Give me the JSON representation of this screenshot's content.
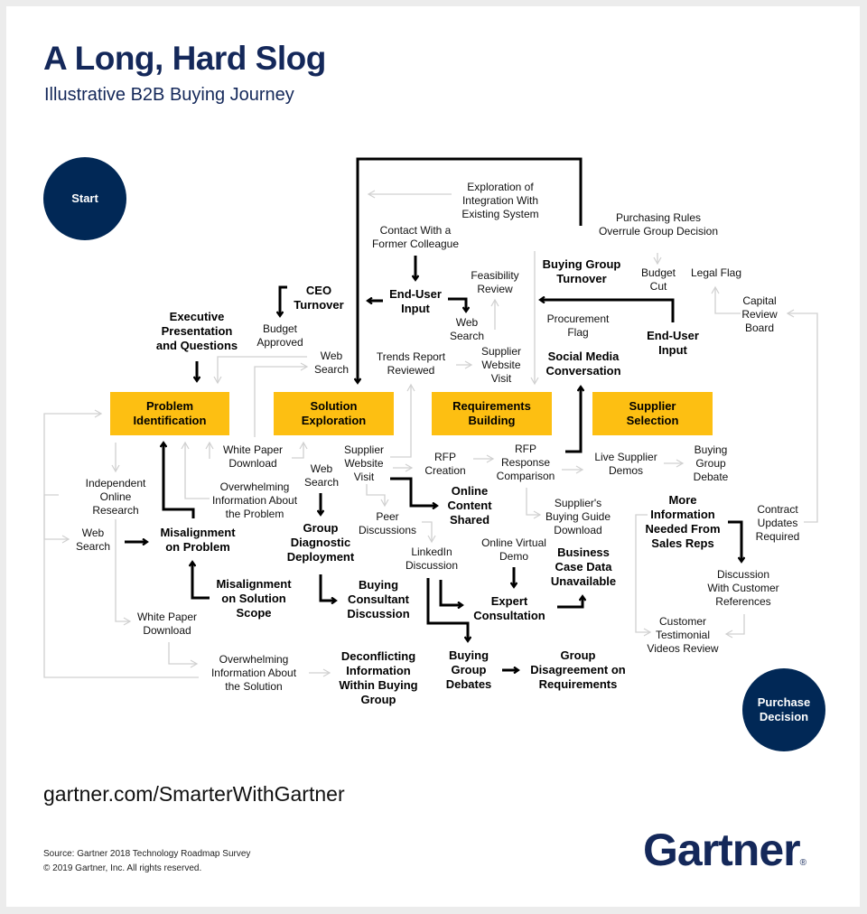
{
  "header": {
    "title": "A Long, Hard Slog",
    "subtitle": "Illustrative B2B Buying Journey"
  },
  "endpoints": {
    "start": "Start",
    "end": "Purchase\nDecision"
  },
  "stages": [
    {
      "id": "problem",
      "label": "Problem\nIdentification"
    },
    {
      "id": "solution",
      "label": "Solution\nExploration"
    },
    {
      "id": "requirements",
      "label": "Requirements\nBuilding"
    },
    {
      "id": "supplier",
      "label": "Supplier\nSelection"
    }
  ],
  "activities": [
    {
      "id": "exploration-integration",
      "label": "Exploration of\nIntegration With\nExisting System",
      "bold": false
    },
    {
      "id": "contact-colleague",
      "label": "Contact With a\nFormer Colleague",
      "bold": false
    },
    {
      "id": "purchasing-rules",
      "label": "Purchasing Rules\nOverrule Group Decision",
      "bold": false
    },
    {
      "id": "buying-group-turnover",
      "label": "Buying Group\nTurnover",
      "bold": true
    },
    {
      "id": "budget-cut",
      "label": "Budget\nCut",
      "bold": false
    },
    {
      "id": "legal-flag",
      "label": "Legal Flag",
      "bold": false
    },
    {
      "id": "ceo-turnover",
      "label": "CEO\nTurnover",
      "bold": true
    },
    {
      "id": "end-user-input-1",
      "label": "End-User\nInput",
      "bold": true
    },
    {
      "id": "feasibility-review",
      "label": "Feasibility\nReview",
      "bold": false
    },
    {
      "id": "capital-review-board",
      "label": "Capital\nReview\nBoard",
      "bold": false
    },
    {
      "id": "executive-presentation",
      "label": "Executive\nPresentation\nand Questions",
      "bold": true
    },
    {
      "id": "budget-approved",
      "label": "Budget\nApproved",
      "bold": false
    },
    {
      "id": "web-search-1",
      "label": "Web\nSearch",
      "bold": false
    },
    {
      "id": "procurement-flag",
      "label": "Procurement\nFlag",
      "bold": false
    },
    {
      "id": "end-user-input-2",
      "label": "End-User\nInput",
      "bold": true
    },
    {
      "id": "web-search-2",
      "label": "Web\nSearch",
      "bold": false
    },
    {
      "id": "trends-report",
      "label": "Trends Report\nReviewed",
      "bold": false
    },
    {
      "id": "supplier-website-1",
      "label": "Supplier\nWebsite\nVisit",
      "bold": false
    },
    {
      "id": "social-media",
      "label": "Social Media\nConversation",
      "bold": true
    },
    {
      "id": "white-paper-1",
      "label": "White Paper\nDownload",
      "bold": false
    },
    {
      "id": "supplier-website-2",
      "label": "Supplier\nWebsite\nVisit",
      "bold": false
    },
    {
      "id": "rfp-creation",
      "label": "RFP\nCreation",
      "bold": false
    },
    {
      "id": "rfp-response",
      "label": "RFP\nResponse\nComparison",
      "bold": false
    },
    {
      "id": "live-demos",
      "label": "Live Supplier\nDemos",
      "bold": false
    },
    {
      "id": "buying-group-debate",
      "label": "Buying\nGroup\nDebate",
      "bold": false
    },
    {
      "id": "independent-research",
      "label": "Independent\nOnline\nResearch",
      "bold": false
    },
    {
      "id": "overwhelming-problem",
      "label": "Overwhelming\nInformation About\nthe Problem",
      "bold": false
    },
    {
      "id": "web-search-3",
      "label": "Web\nSearch",
      "bold": false
    },
    {
      "id": "online-content",
      "label": "Online\nContent\nShared",
      "bold": true
    },
    {
      "id": "suppliers-guide",
      "label": "Supplier's\nBuying Guide\nDownload",
      "bold": false
    },
    {
      "id": "more-information",
      "label": "More\nInformation\nNeeded From\nSales Reps",
      "bold": true
    },
    {
      "id": "contract-updates",
      "label": "Contract\nUpdates\nRequired",
      "bold": false
    },
    {
      "id": "web-search-4",
      "label": "Web\nSearch",
      "bold": false
    },
    {
      "id": "misalignment-problem",
      "label": "Misalignment\non Problem",
      "bold": true
    },
    {
      "id": "group-diagnostic",
      "label": "Group\nDiagnostic\nDeployment",
      "bold": true
    },
    {
      "id": "peer-discussions",
      "label": "Peer\nDiscussions",
      "bold": false
    },
    {
      "id": "linkedin",
      "label": "LinkedIn\nDiscussion",
      "bold": false
    },
    {
      "id": "online-virtual-demo",
      "label": "Online Virtual\nDemo",
      "bold": false
    },
    {
      "id": "business-case",
      "label": "Business\nCase Data\nUnavailable",
      "bold": true
    },
    {
      "id": "discussion-references",
      "label": "Discussion\nWith Customer\nReferences",
      "bold": false
    },
    {
      "id": "misalignment-scope",
      "label": "Misalignment\non Solution\nScope",
      "bold": true
    },
    {
      "id": "buying-consultant",
      "label": "Buying\nConsultant\nDiscussion",
      "bold": true
    },
    {
      "id": "expert-consultation",
      "label": "Expert\nConsultation",
      "bold": true
    },
    {
      "id": "white-paper-2",
      "label": "White Paper\nDownload",
      "bold": false
    },
    {
      "id": "customer-testimonial",
      "label": "Customer\nTestimonial\nVideos Review",
      "bold": false
    },
    {
      "id": "overwhelming-solution",
      "label": "Overwhelming\nInformation About\nthe Solution",
      "bold": false
    },
    {
      "id": "deconflicting",
      "label": "Deconflicting\nInformation\nWithin Buying\nGroup",
      "bold": true
    },
    {
      "id": "buying-group-debates",
      "label": "Buying\nGroup\nDebates",
      "bold": true
    },
    {
      "id": "group-disagreement",
      "label": "Group\nDisagreement on\nRequirements",
      "bold": true
    }
  ],
  "colors": {
    "navy": "#012856",
    "title_navy": "#14285a",
    "stage_yellow": "#fdbf12",
    "strong_line": "#000000",
    "weak_line": "#d0d0d0"
  },
  "footer": {
    "url": "gartner.com/SmarterWithGartner",
    "source": "Source: Gartner 2018 Technology Roadmap Survey",
    "copyright": "© 2019 Gartner, Inc. All rights reserved.",
    "logo": "Gartner",
    "logo_mark": "®"
  }
}
